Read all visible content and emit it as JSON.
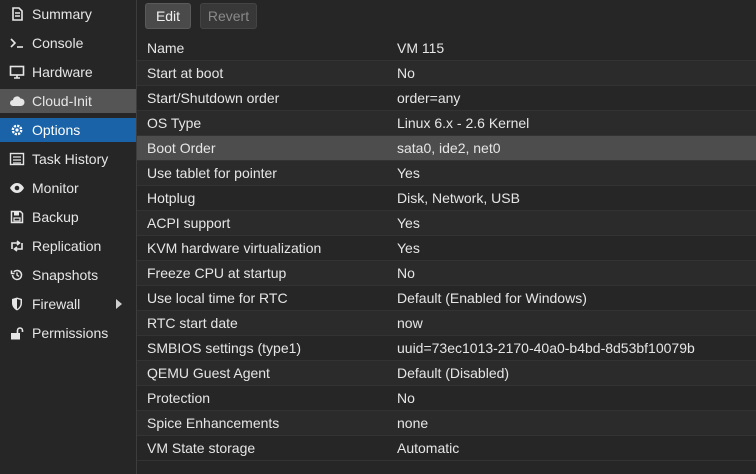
{
  "sidebar": {
    "items": [
      {
        "label": "Summary",
        "icon": "summary-icon"
      },
      {
        "label": "Console",
        "icon": "console-icon"
      },
      {
        "label": "Hardware",
        "icon": "monitor-icon"
      },
      {
        "label": "Cloud-Init",
        "icon": "cloud-icon"
      },
      {
        "label": "Options",
        "icon": "gear-icon"
      },
      {
        "label": "Task History",
        "icon": "list-icon"
      },
      {
        "label": "Monitor",
        "icon": "eye-icon"
      },
      {
        "label": "Backup",
        "icon": "floppy-icon"
      },
      {
        "label": "Replication",
        "icon": "retweet-icon"
      },
      {
        "label": "Snapshots",
        "icon": "history-icon"
      },
      {
        "label": "Firewall",
        "icon": "shield-icon"
      },
      {
        "label": "Permissions",
        "icon": "unlock-icon"
      }
    ],
    "hovered": "Cloud-Init",
    "selected": "Options"
  },
  "toolbar": {
    "edit_label": "Edit",
    "revert_label": "Revert"
  },
  "options": [
    {
      "name": "Name",
      "value": "VM 115"
    },
    {
      "name": "Start at boot",
      "value": "No"
    },
    {
      "name": "Start/Shutdown order",
      "value": "order=any"
    },
    {
      "name": "OS Type",
      "value": "Linux 6.x - 2.6 Kernel"
    },
    {
      "name": "Boot Order",
      "value": "sata0, ide2, net0"
    },
    {
      "name": "Use tablet for pointer",
      "value": "Yes"
    },
    {
      "name": "Hotplug",
      "value": "Disk, Network, USB"
    },
    {
      "name": "ACPI support",
      "value": "Yes"
    },
    {
      "name": "KVM hardware virtualization",
      "value": "Yes"
    },
    {
      "name": "Freeze CPU at startup",
      "value": "No"
    },
    {
      "name": "Use local time for RTC",
      "value": "Default (Enabled for Windows)"
    },
    {
      "name": "RTC start date",
      "value": "now"
    },
    {
      "name": "SMBIOS settings (type1)",
      "value": "uuid=73ec1013-2170-40a0-b4bd-8d53bf10079b"
    },
    {
      "name": "QEMU Guest Agent",
      "value": "Default (Disabled)"
    },
    {
      "name": "Protection",
      "value": "No"
    },
    {
      "name": "Spice Enhancements",
      "value": "none"
    },
    {
      "name": "VM State storage",
      "value": "Automatic"
    }
  ],
  "selected_option": "Boot Order",
  "colors": {
    "background": "#262626",
    "selected_nav": "#1a63a8",
    "hover_nav": "#555555",
    "selected_row": "#4d4d4d",
    "text": "#e6e6e6"
  }
}
